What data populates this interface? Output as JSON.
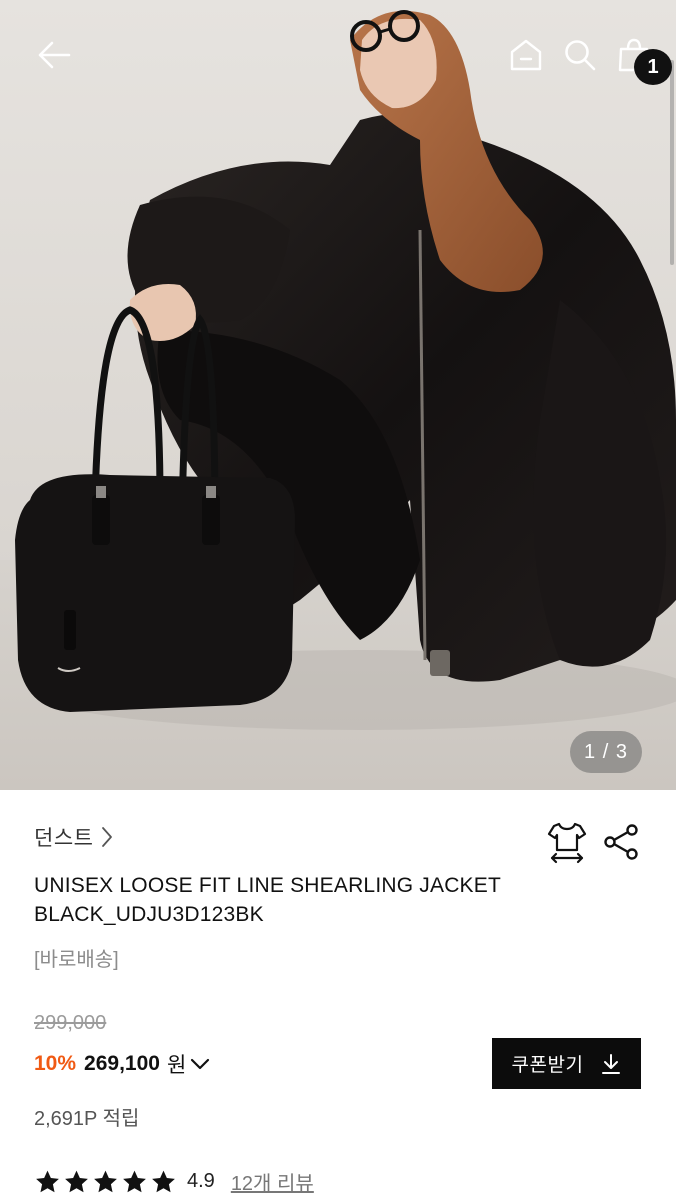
{
  "header": {
    "back_icon": "arrow-left-icon",
    "home_icon": "home-icon",
    "search_icon": "search-icon",
    "cart_icon": "shopping-bag-icon",
    "cart_count": "1"
  },
  "gallery": {
    "page_indicator": "1 / 3",
    "current": 1,
    "total": 3
  },
  "product": {
    "brand": "던스트",
    "name": "UNISEX LOOSE FIT LINE SHEARLING JACKET BLACK_UDJU3D123BK",
    "delivery_tag": "[바로배송]",
    "original_price": "299,000",
    "discount_rate": "10%",
    "sale_price": "269,100",
    "currency": "원",
    "points": "2,691P 적립",
    "rating": "4.9",
    "rating_value": 4.9,
    "stars_total": 5,
    "review_count": "12개 리뷰"
  },
  "actions": {
    "coupon_label": "쿠폰받기",
    "size_icon": "size-guide-icon",
    "share_icon": "share-icon"
  },
  "colors": {
    "accent_discount": "#f05a14",
    "coupon_bg": "#0c0c0c",
    "muted_text": "#8c8c8c"
  }
}
